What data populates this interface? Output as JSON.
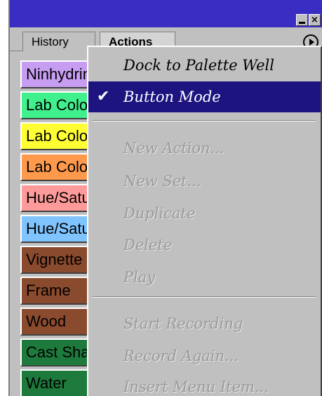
{
  "window": {
    "minimize_glyph": "",
    "close_glyph": "×"
  },
  "tabs": [
    {
      "label": "History"
    },
    {
      "label": "Actions"
    }
  ],
  "palette_menu_icon": "right-triangle-circle-icon",
  "actions": [
    {
      "label": "Ninhydrin",
      "color": "#c79df2"
    },
    {
      "label": "Lab Color",
      "color": "#40f08c"
    },
    {
      "label": "Lab Color",
      "color": "#ffff33"
    },
    {
      "label": "Lab Color",
      "color": "#ff9a4d"
    },
    {
      "label": "Hue/Saturation",
      "color": "#ff9a9a"
    },
    {
      "label": "Hue/Saturation",
      "color": "#7fc4ff"
    },
    {
      "label": "Vignette",
      "color": "#8a4a2e"
    },
    {
      "label": "Frame",
      "color": "#8a4a2e"
    },
    {
      "label": "Wood",
      "color": "#8a4a2e"
    },
    {
      "label": "Cast Shadow",
      "color": "#1e7a3c"
    },
    {
      "label": "Water",
      "color": "#1e7a3c"
    }
  ],
  "menu": {
    "items": [
      {
        "label": "Dock to Palette Well",
        "enabled": true,
        "checked": false,
        "selected": false
      },
      {
        "label": "Button Mode",
        "enabled": true,
        "checked": true,
        "selected": true
      },
      {
        "label": "New Action...",
        "enabled": false,
        "checked": false,
        "selected": false
      },
      {
        "label": "New Set...",
        "enabled": false,
        "checked": false,
        "selected": false
      },
      {
        "label": "Duplicate",
        "enabled": false,
        "checked": false,
        "selected": false
      },
      {
        "label": "Delete",
        "enabled": false,
        "checked": false,
        "selected": false
      },
      {
        "label": "Play",
        "enabled": false,
        "checked": false,
        "selected": false
      },
      {
        "label": "Start Recording",
        "enabled": false,
        "checked": false,
        "selected": false
      },
      {
        "label": "Record Again...",
        "enabled": false,
        "checked": false,
        "selected": false
      },
      {
        "label": "Insert Menu Item...",
        "enabled": false,
        "checked": false,
        "selected": false
      }
    ],
    "check_glyph": "✔"
  },
  "colors": {
    "titlebar": "#3a2ec2",
    "menu_highlight": "#1d1480",
    "palette_bg": "#c0c0c0"
  }
}
